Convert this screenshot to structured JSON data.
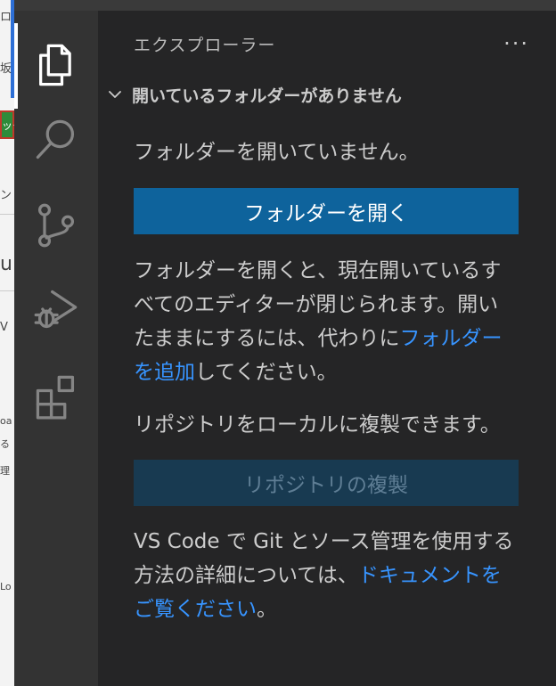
{
  "sidebar": {
    "title": "エクスプローラー",
    "more": "···",
    "section_title": "開いているフォルダーがありません",
    "no_folder_text": "フォルダーを開いていません。",
    "open_folder_button": "フォルダーを開く",
    "open_info_before": "フォルダーを開くと、現在開いているすべてのエディターが閉じられます。開いたままにするには、代わりに",
    "open_info_link": "フォルダーを追加",
    "open_info_after": "してください。",
    "clone_text": "リポジトリをローカルに複製できます。",
    "clone_button": "リポジトリの複製",
    "git_info_before": "VS Code で Git とソース管理を使用する方法の詳細については、",
    "git_info_link": "ドキュメントをご覧ください",
    "git_info_after": "。"
  },
  "background_window": {
    "fragments": [
      "ロ",
      "坂",
      "ック",
      "ン",
      "u",
      "V",
      "oa",
      "る",
      "理",
      "Lo"
    ]
  },
  "colors": {
    "activity_bar": "#333333",
    "sidebar": "#252526",
    "primary_button": "#0e639c",
    "disabled_button": "#183a51",
    "link": "#3794ff"
  },
  "activity_icons": [
    "files-icon",
    "search-icon",
    "source-control-icon",
    "run-debug-icon",
    "extensions-icon"
  ]
}
